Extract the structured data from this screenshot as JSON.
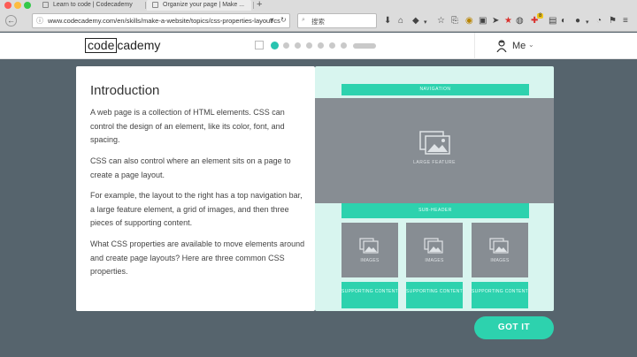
{
  "browser": {
    "tabs": [
      {
        "title": "Learn to code | Codecademy"
      },
      {
        "title": "Organize your page | Make ..."
      }
    ],
    "new_tab_label": "+",
    "url": "www.codecademy.com/en/skills/make-a-website/topics/css-properties-layout/cs",
    "search_placeholder": "搜索",
    "toolbar_badge": "8"
  },
  "header": {
    "logo_box_text": "code",
    "logo_rest_text": "cademy",
    "progress_step_count": 8,
    "active_step": 1,
    "user_label": "Me",
    "user_chevron": "⌄"
  },
  "lesson": {
    "title": "Introduction",
    "paragraphs": [
      "A web page is a collection of HTML elements. CSS can control the design of an element, like its color, font, and spacing.",
      "CSS can also control where an element sits on a page to create a page layout.",
      "For example, the layout to the right has a top navigation bar, a large feature element, a grid of images, and then three pieces of supporting content.",
      "What CSS properties are available to move elements around and create page layouts? Here are three common CSS properties."
    ]
  },
  "demo": {
    "navigation": "NAVIGATION",
    "feature": "LARGE FEATURE",
    "subheader": "SUB-HEADER",
    "images": [
      "IMAGES",
      "IMAGES",
      "IMAGES"
    ],
    "supporting": [
      "SUPPORTING CONTENT",
      "SUPPORTING CONTENT",
      "SUPPORTING CONTENT"
    ]
  },
  "actions": {
    "got_it": "GOT IT"
  },
  "colors": {
    "accent": "#2dd2ae",
    "page_bg": "#56646d",
    "demo_bg": "#d8f5ef",
    "placeholder_gray": "#878d93"
  }
}
